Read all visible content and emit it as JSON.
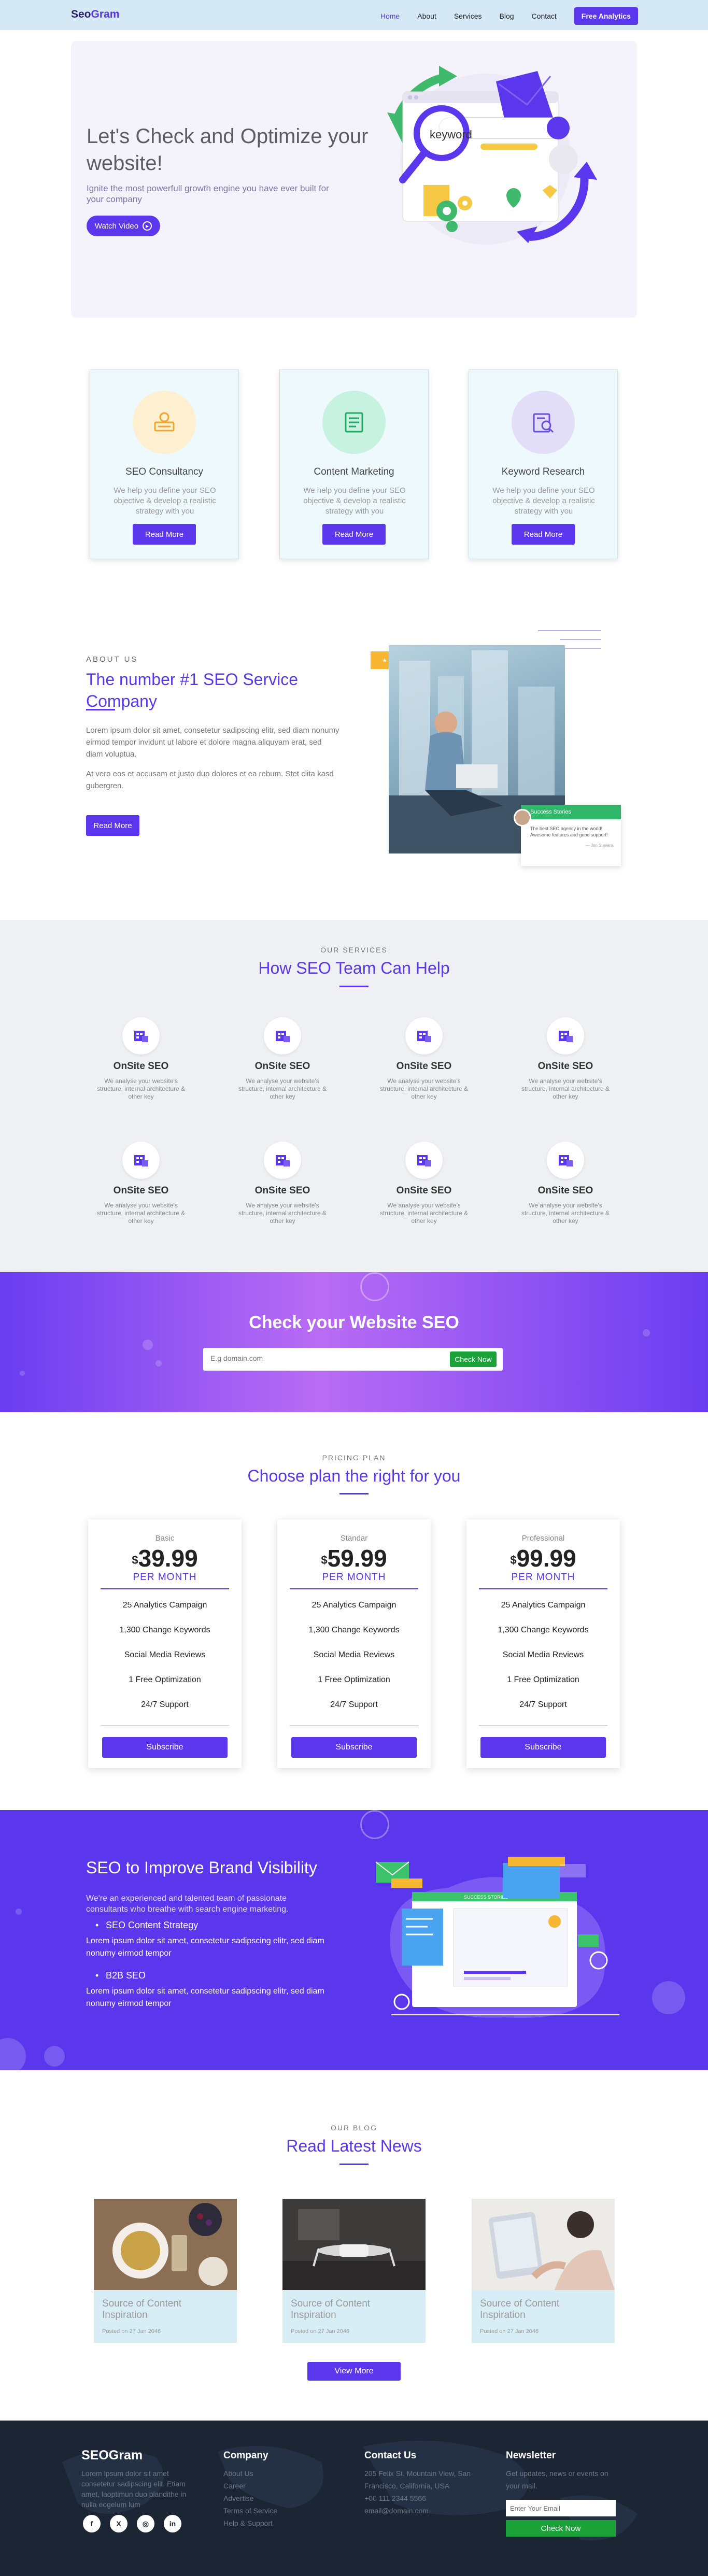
{
  "nav": {
    "logo_a": "Seo",
    "logo_b": "Gram",
    "links": [
      "Home",
      "About",
      "Services",
      "Blog",
      "Contact"
    ],
    "cta": "Free Analytics"
  },
  "hero": {
    "title": "Let's Check and Optimize your website!",
    "subtitle": "Ignite the most powerfull growth engine you have ever built for your company",
    "video_btn": "Watch Video",
    "illustration_text": "keyword"
  },
  "features": [
    {
      "title": "SEO Consultancy",
      "text": "We help you define your SEO objective & develop a realistic strategy with you",
      "btn": "Read More",
      "color": "#fdefd0",
      "icon": "consultancy-icon"
    },
    {
      "title": "Content Marketing",
      "text": "We help you define your SEO objective & develop a realistic strategy with you",
      "btn": "Read More",
      "color": "#c7f2df",
      "icon": "content-marketing-icon"
    },
    {
      "title": "Keyword Research",
      "text": "We help you define your SEO objective & develop a realistic strategy with you",
      "btn": "Read More",
      "color": "#e3def8",
      "icon": "keyword-research-icon"
    }
  ],
  "about": {
    "label": "ABOUT US",
    "title": "The number #1 SEO Service Company",
    "p1": "Lorem ipsum dolor sit amet, consetetur sadipscing elitr, sed diam nonumy eirmod tempor invidunt ut labore et dolore magna aliquyam erat, sed diam voluptua.",
    "p2": "At vero eos et accusam et justo duo dolores et ea rebum. Stet clita kasd gubergren.",
    "btn": "Read More",
    "badge": "★ ★ ★",
    "story_title": "Success Stories",
    "story_text": "The best SEO agency in the world! Awesome features and good support!",
    "story_author": "— Jon Stevens"
  },
  "services": {
    "label": "OUR SERVICES",
    "title": "How SEO Team Can Help",
    "items": [
      {
        "title": "OnSite SEO",
        "text": "We analyse your website's structure, internal architecture & other key"
      },
      {
        "title": "OnSite SEO",
        "text": "We analyse your website's structure, internal architecture & other key"
      },
      {
        "title": "OnSite SEO",
        "text": "We analyse your website's structure, internal architecture & other key"
      },
      {
        "title": "OnSite SEO",
        "text": "We analyse your website's structure, internal architecture & other key"
      },
      {
        "title": "OnSite SEO",
        "text": "We analyse your website's structure, internal architecture & other key"
      },
      {
        "title": "OnSite SEO",
        "text": "We analyse your website's structure, internal architecture & other key"
      },
      {
        "title": "OnSite SEO",
        "text": "We analyse your website's structure, internal architecture & other key"
      },
      {
        "title": "OnSite SEO",
        "text": "We analyse your website's structure, internal architecture & other key"
      }
    ]
  },
  "check": {
    "title": "Check your Website SEO",
    "placeholder": "E.g domain.com",
    "btn": "Check Now"
  },
  "pricing": {
    "label": "PRICING PLAN",
    "title": "Choose plan the right for you",
    "plans": [
      {
        "name": "Basic",
        "currency": "$",
        "price": "39.99",
        "period": "PER MONTH",
        "features": [
          "25 Analytics Campaign",
          "1,300 Change Keywords",
          "Social Media Reviews",
          "1 Free Optimization",
          "24/7 Support"
        ],
        "btn": "Subscribe"
      },
      {
        "name": "Standar",
        "currency": "$",
        "price": "59.99",
        "period": "PER MONTH",
        "features": [
          "25 Analytics Campaign",
          "1,300 Change Keywords",
          "Social Media Reviews",
          "1 Free Optimization",
          "24/7 Support"
        ],
        "btn": "Subscribe"
      },
      {
        "name": "Professional",
        "currency": "$",
        "price": "99.99",
        "period": "PER MONTH",
        "features": [
          "25 Analytics Campaign",
          "1,300 Change Keywords",
          "Social Media Reviews",
          "1 Free Optimization",
          "24/7 Support"
        ],
        "btn": "Subscribe"
      }
    ]
  },
  "brand": {
    "title": "SEO to Improve Brand Visibility",
    "lead": "We're an experienced and talented team of passionate consultants who breathe with search engine marketing.",
    "h1": "SEO Content Strategy",
    "t1": "Lorem ipsum dolor sit amet, consetetur sadipscing elitr, sed diam nonumy eirmod tempor",
    "h2": "B2B SEO",
    "t2": "Lorem ipsum dolor sit amet, consetetur sadipscing elitr, sed diam nonumy eirmod tempor",
    "dash_label": "SUCCESS STORIES"
  },
  "blog": {
    "label": "OUR BLOG",
    "title": "Read Latest News",
    "posts": [
      {
        "title": "Source of Content Inspiration",
        "date": "Posted on 27 Jan 2046"
      },
      {
        "title": "Source of Content Inspiration",
        "date": "Posted on 27 Jan 2046"
      },
      {
        "title": "Source of Content Inspiration",
        "date": "Posted on 27 Jan 2046"
      }
    ],
    "btn": "View More"
  },
  "footer": {
    "logo": "SEOGram",
    "about": "Lorem ipsum dolor sit amet consetetur sadipscing elit. Etiam amet, laoptimun duo blandithe in nulla eogelum lum",
    "company_title": "Company",
    "company_links": [
      "About Us",
      "Career",
      "Advertise",
      "Terms of Service",
      "Help & Support"
    ],
    "contact_title": "Contact Us",
    "contact_lines": [
      "205 Felix St. Mountain View, San",
      "Francisco, California, USA",
      "+00 111 2344 5566",
      "email@domain.com"
    ],
    "news_title": "Newsletter",
    "news_text": "Get updates, news or events on your mail.",
    "news_placeholder": "Enter Your Email",
    "news_btn": "Check Now",
    "social": [
      "f",
      "X",
      "◎",
      "in"
    ]
  }
}
